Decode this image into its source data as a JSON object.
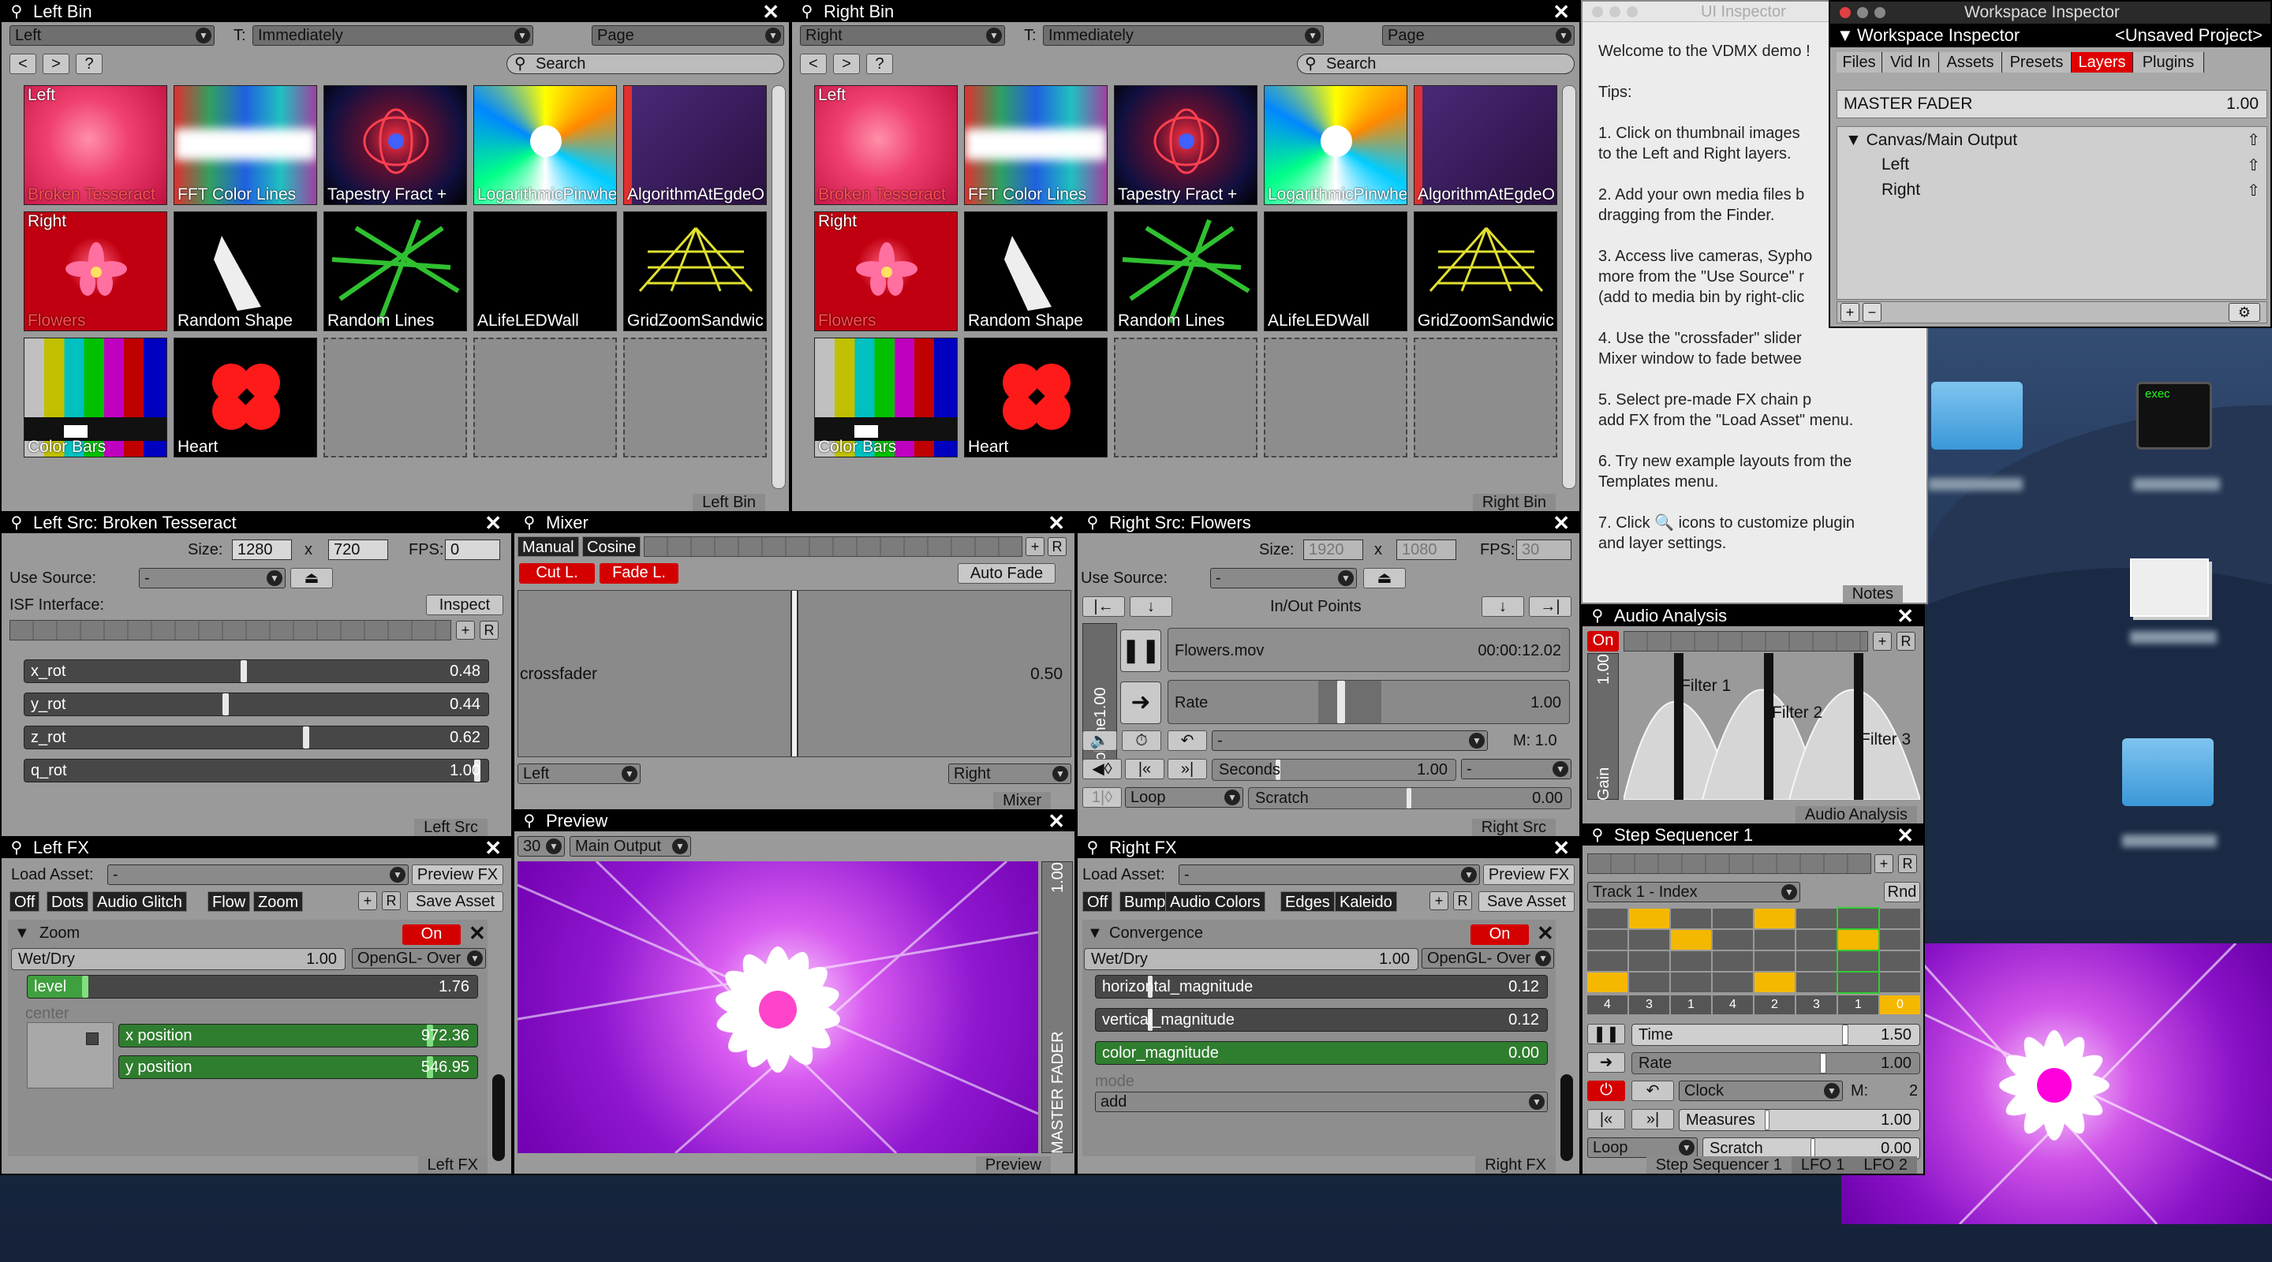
{
  "left_bin": {
    "title": "Left Bin",
    "layer": "Left",
    "trigger_label": "T:",
    "trigger": "Immediately",
    "page": "Page",
    "search_placeholder": "Search",
    "footer": "Left Bin",
    "clips": [
      {
        "name": "Broken Tesseract",
        "tag": "Left",
        "red": true
      },
      {
        "name": "FFT Color Lines"
      },
      {
        "name": "Tapestry Fract +"
      },
      {
        "name": "LogarithmicPinwhe"
      },
      {
        "name": "AlgorithmAtEgdeO"
      },
      {
        "name": "Flowers",
        "tag": "Right",
        "red": true
      },
      {
        "name": "Random Shape"
      },
      {
        "name": "Random Lines"
      },
      {
        "name": "ALifeLEDWall"
      },
      {
        "name": "GridZoomSandwic"
      },
      {
        "name": "Color Bars"
      },
      {
        "name": "Heart"
      }
    ]
  },
  "right_bin": {
    "title": "Right Bin",
    "layer": "Right",
    "trigger_label": "T:",
    "trigger": "Immediately",
    "page": "Page",
    "search_placeholder": "Search",
    "footer": "Right Bin",
    "clips": [
      {
        "name": "Broken Tesseract",
        "tag": "Left",
        "red": true
      },
      {
        "name": "FFT Color Lines"
      },
      {
        "name": "Tapestry Fract +"
      },
      {
        "name": "LogarithmicPinwhe"
      },
      {
        "name": "AlgorithmAtEgdeO"
      },
      {
        "name": "Flowers",
        "tag": "Right",
        "red": true
      },
      {
        "name": "Random Shape"
      },
      {
        "name": "Random Lines"
      },
      {
        "name": "ALifeLEDWall"
      },
      {
        "name": "GridZoomSandwic"
      },
      {
        "name": "Color Bars"
      },
      {
        "name": "Heart"
      }
    ]
  },
  "nav": {
    "back": "<",
    "fwd": ">",
    "help": "?"
  },
  "ui_inspector": {
    "title": "UI Inspector",
    "text": "Welcome to the VDMX demo !\n\nTips:\n\n1. Click on thumbnail images\nto the Left and Right layers.\n\n2. Add your own media files b\ndragging from the Finder.\n\n3. Access live cameras, Sypho\nmore from the \"Use Source\" r\n(add to media bin by right-clic\n\n4. Use the \"crossfader\" slider\nMixer window to fade betwee\n\n5. Select pre-made FX chain p\nadd FX from the \"Load Asset\" menu.\n\n6. Try new example layouts from the\nTemplates menu.\n\n7. Click 🔍 icons to customize plugin\nand layer settings.\n\n\nVisit http://vdmx.vidvox.net for more\nexamples, tutorials and sample clips.",
    "footer": "Notes"
  },
  "workspace": {
    "window_title": "Workspace Inspector",
    "header": "Workspace Inspector",
    "project": "<Unsaved Project>",
    "tabs": [
      "Files",
      "Vid In",
      "Assets",
      "Presets",
      "Layers",
      "Plugins"
    ],
    "active_tab": "Layers",
    "master_label": "MASTER FADER",
    "master_value": "1.00",
    "tree_root": "Canvas/Main Output",
    "tree_children": [
      "Left",
      "Right"
    ],
    "add": "+",
    "remove": "−"
  },
  "left_src": {
    "title": "Left Src: Broken Tesseract",
    "size_label": "Size:",
    "w": "1280",
    "x": "x",
    "h": "720",
    "fps_label": "FPS:",
    "fps": "0",
    "use_source_label": "Use Source:",
    "use_source": "-",
    "isf_label": "ISF Interface:",
    "inspect": "Inspect",
    "footer": "Left Src",
    "params": [
      {
        "name": "x_rot",
        "value": "0.48",
        "pos": 0.48
      },
      {
        "name": "y_rot",
        "value": "0.44",
        "pos": 0.44
      },
      {
        "name": "z_rot",
        "value": "0.62",
        "pos": 0.62
      },
      {
        "name": "q_rot",
        "value": "1.00",
        "pos": 1.0
      }
    ]
  },
  "mixer": {
    "title": "Mixer",
    "mode1": "Manual",
    "mode2": "Cosine",
    "cut": "Cut L.",
    "fade": "Fade L.",
    "auto": "Auto Fade",
    "cross_label": "crossfader",
    "cross_value": "0.50",
    "cross_pos": 0.5,
    "left": "Left",
    "right": "Right",
    "footer": "Mixer"
  },
  "right_src": {
    "title": "Right Src: Flowers",
    "size_label": "Size:",
    "w": "1920",
    "x": "x",
    "h": "1080",
    "fps_label": "FPS:",
    "fps": "30",
    "use_source_label": "Use Source:",
    "use_source": "-",
    "inout": "In/Out Points",
    "volume_label": "Volume",
    "volume": "1.00",
    "file": "Flowers.mov",
    "time": "00:00:12.02",
    "rate_label": "Rate",
    "rate": "1.00",
    "m_label": "M:",
    "m": "1.0",
    "seconds_label": "Seconds",
    "seconds": "1.00",
    "loop": "Loop",
    "scratch_label": "Scratch",
    "scratch": "0.00",
    "footer": "Right Src",
    "time_pos": 0.98,
    "rate_pos": 0.42
  },
  "left_fx": {
    "title": "Left FX",
    "load_label": "Load Asset:",
    "load": "-",
    "preview": "Preview FX",
    "save": "Save Asset",
    "chips": [
      "Off",
      "Dots",
      "Audio Glitch",
      "Flow",
      "Zoom"
    ],
    "effect": "Zoom",
    "on": "On",
    "wetdry_label": "Wet/Dry",
    "wetdry": "1.00",
    "blend": "OpenGL- Over",
    "level_label": "level",
    "level": "1.76",
    "level_pos": 0.12,
    "center": "center",
    "xpos_label": "x position",
    "xpos": "972.36",
    "ypos_label": "y position",
    "ypos": "546.95",
    "footer": "Left FX"
  },
  "preview": {
    "title": "Preview",
    "fps": "30",
    "output": "Main Output",
    "master": "MASTER FADER",
    "master_val": "1.00",
    "footer": "Preview"
  },
  "right_fx": {
    "title": "Right FX",
    "load_label": "Load Asset:",
    "load": "-",
    "preview": "Preview FX",
    "save": "Save Asset",
    "chips": [
      "Off",
      "Bump",
      "Audio Colors",
      "Edges",
      "Kaleido"
    ],
    "effect": "Convergence",
    "on": "On",
    "wetdry_label": "Wet/Dry",
    "wetdry": "1.00",
    "blend": "OpenGL- Over",
    "params": [
      {
        "name": "horizontal_magnitude",
        "value": "0.12"
      },
      {
        "name": "vertical_magnitude",
        "value": "0.12"
      },
      {
        "name": "color_magnitude",
        "value": "0.00"
      }
    ],
    "mode_label": "mode",
    "mode": "add",
    "footer": "Right FX"
  },
  "audio": {
    "title": "Audio Analysis",
    "on": "On",
    "gain_label": "Gain",
    "gain": "1.00",
    "filters": [
      "Filter 1",
      "Filter 2",
      "Filter 3"
    ],
    "footer": "Audio Analysis"
  },
  "step": {
    "title": "Step Sequencer 1",
    "track": "Track 1 - Index",
    "rnd": "Rnd",
    "indices": [
      "4",
      "3",
      "1",
      "4",
      "2",
      "3",
      "1",
      "0"
    ],
    "time_label": "Time",
    "time": "1.50",
    "rate_label": "Rate",
    "rate": "1.00",
    "clock": "Clock",
    "m_label": "M:",
    "m": "2",
    "measures_label": "Measures",
    "measures": "1.00",
    "loop": "Loop",
    "scratch_label": "Scratch",
    "scratch": "0.00",
    "footers": [
      "Step Sequencer 1",
      "LFO 1",
      "LFO 2"
    ]
  },
  "desktop": {
    "exec": "exec"
  }
}
